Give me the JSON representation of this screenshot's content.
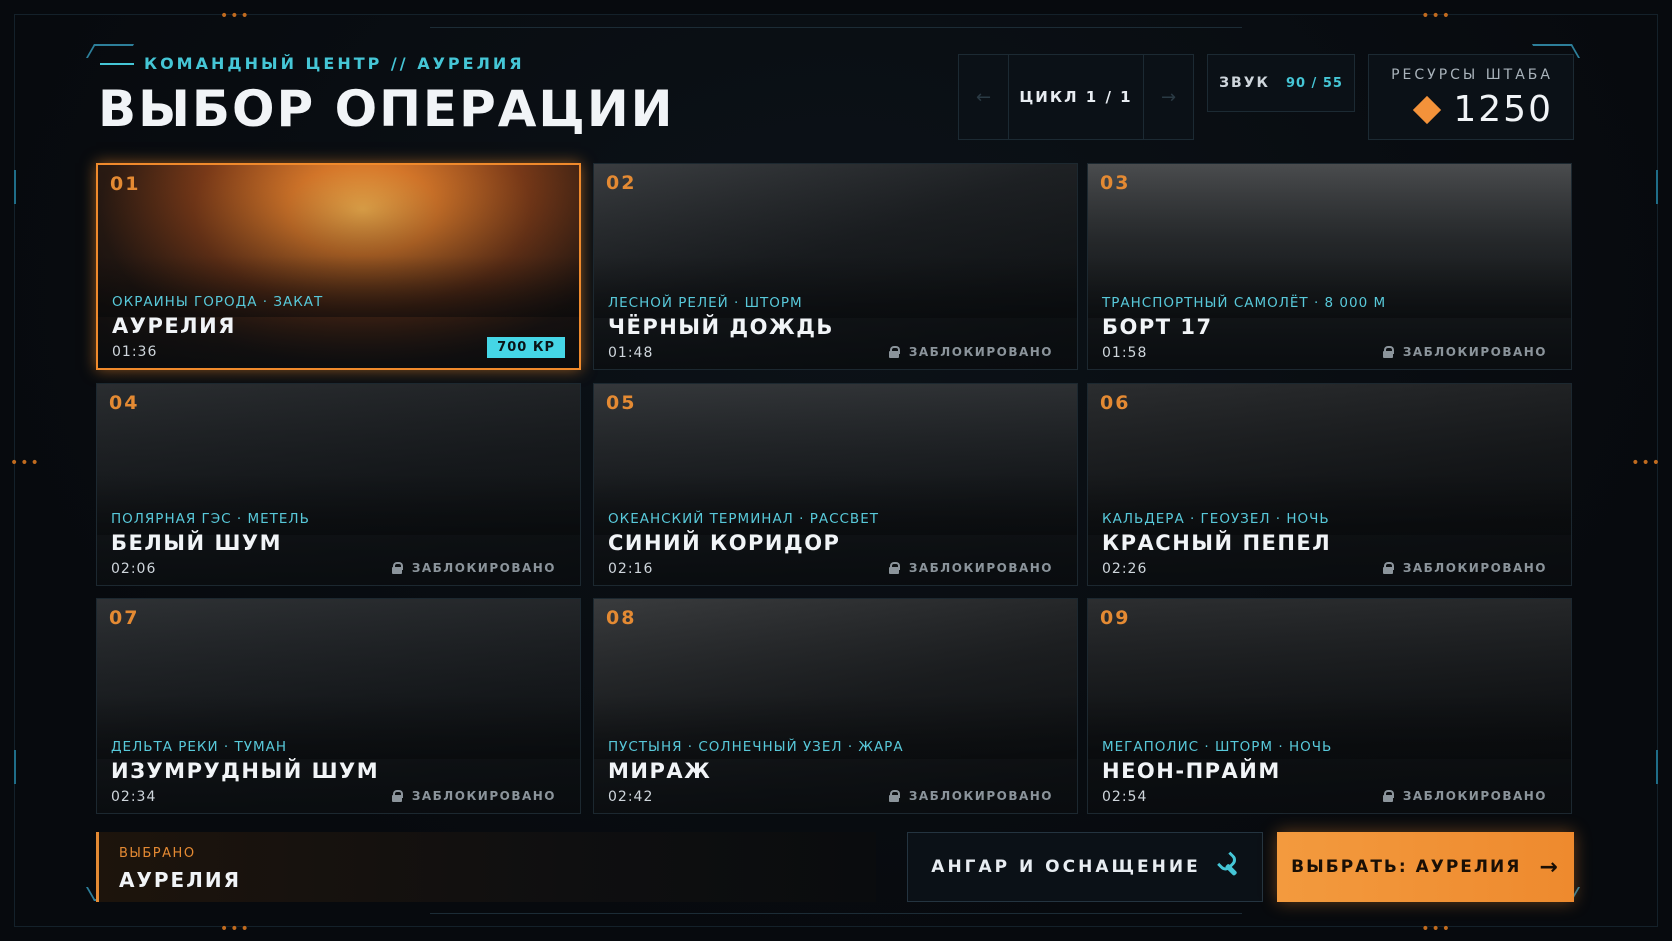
{
  "header": {
    "breadcrumb": "КОМАНДНЫЙ ЦЕНТР // АУРЕЛИЯ",
    "title": "ВЫБОР ОПЕРАЦИИ"
  },
  "cycle": {
    "label": "ЦИКЛ 1 / 1",
    "prev_icon": "arrow-left-icon",
    "next_icon": "arrow-right-icon"
  },
  "sound": {
    "label": "ЗВУК",
    "value": "90 / 55"
  },
  "resources": {
    "label": "РЕСУРСЫ ШТАБА",
    "value": "1250",
    "icon": "diamond-icon"
  },
  "colors": {
    "accent": "#e48a33",
    "cyan": "#45c6d6",
    "background": "#070a0e"
  },
  "missions": [
    {
      "num": "01",
      "subtitle": "ОКРАИНЫ ГОРОДА · ЗАКАТ",
      "name": "АУРЕЛИЯ",
      "time": "01:36",
      "status": "700 КР",
      "locked": false,
      "selected": true
    },
    {
      "num": "02",
      "subtitle": "ЛЕСНОЙ РЕЛЕЙ · ШТОРМ",
      "name": "ЧЁРНЫЙ ДОЖДЬ",
      "time": "01:48",
      "status": "ЗАБЛОКИРОВАНО",
      "locked": true
    },
    {
      "num": "03",
      "subtitle": "ТРАНСПОРТНЫЙ САМОЛЁТ · 8 000 М",
      "name": "БОРТ 17",
      "time": "01:58",
      "status": "ЗАБЛОКИРОВАНО",
      "locked": true
    },
    {
      "num": "04",
      "subtitle": "ПОЛЯРНАЯ ГЭС · МЕТЕЛЬ",
      "name": "БЕЛЫЙ ШУМ",
      "time": "02:06",
      "status": "ЗАБЛОКИРОВАНО",
      "locked": true
    },
    {
      "num": "05",
      "subtitle": "ОКЕАНСКИЙ ТЕРМИНАЛ · РАССВЕТ",
      "name": "СИНИЙ КОРИДОР",
      "time": "02:16",
      "status": "ЗАБЛОКИРОВАНО",
      "locked": true
    },
    {
      "num": "06",
      "subtitle": "КАЛЬДЕРА · ГЕОУЗЕЛ · НОЧЬ",
      "name": "КРАСНЫЙ ПЕПЕЛ",
      "time": "02:26",
      "status": "ЗАБЛОКИРОВАНО",
      "locked": true
    },
    {
      "num": "07",
      "subtitle": "ДЕЛЬТА РЕКИ · ТУМАН",
      "name": "ИЗУМРУДНЫЙ ШУМ",
      "time": "02:34",
      "status": "ЗАБЛОКИРОВАНО",
      "locked": true
    },
    {
      "num": "08",
      "subtitle": "ПУСТЫНЯ · СОЛНЕЧНЫЙ УЗЕЛ · ЖАРА",
      "name": "МИРАЖ",
      "time": "02:42",
      "status": "ЗАБЛОКИРОВАНО",
      "locked": true
    },
    {
      "num": "09",
      "subtitle": "МЕГАПОЛИС · ШТОРМ · НОЧЬ",
      "name": "НЕОН-ПРАЙМ",
      "time": "02:54",
      "status": "ЗАБЛОКИРОВАНО",
      "locked": true
    }
  ],
  "footer": {
    "selected_label": "ВЫБРАНО",
    "selected_value": "АУРЕЛИЯ",
    "hangar_label": "АНГАР И ОСНАЩЕНИЕ",
    "hangar_icon": "wrench-icon",
    "choose_label": "ВЫБРАТЬ: АУРЕЛИЯ",
    "choose_icon": "arrow-right-icon"
  }
}
